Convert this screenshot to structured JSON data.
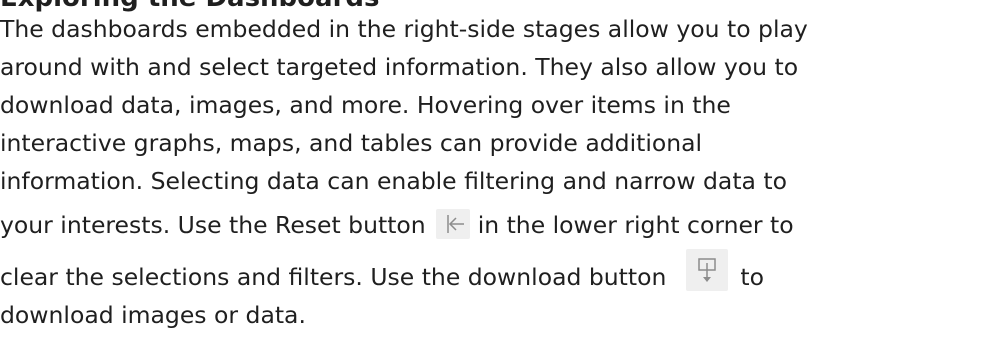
{
  "section": {
    "heading": "Exploring the Dashboards"
  },
  "paragraph": {
    "line1": "The dashboards embedded in the right-side stages allow you to play",
    "line2": "around with and select targeted information. They also allow you to",
    "line3": "download data, images, and more. Hovering over items in the",
    "line4": "interactive graphs, maps, and tables can provide additional",
    "line5": "information. Selecting data can enable filtering and narrow data to",
    "line6_before": "your interests. Use the Reset button",
    "line6_after": "in the lower right corner to",
    "line7_before": "clear the selections and filters. Use the download button",
    "line7_after": "to",
    "line8": "download images or data."
  },
  "icons": {
    "reset": "reset-icon",
    "download": "download-icon"
  }
}
